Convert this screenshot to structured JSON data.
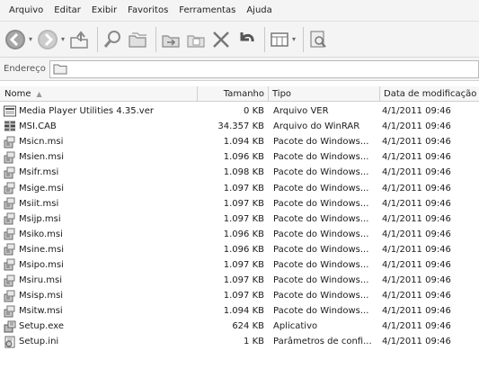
{
  "menu": [
    "Arquivo",
    "Editar",
    "Exibir",
    "Favoritos",
    "Ferramentas",
    "Ajuda"
  ],
  "toolbar": {
    "icons": [
      "back-icon",
      "forward-icon",
      "up-folder-icon",
      "search-icon",
      "folders-icon",
      "move-to-icon",
      "copy-to-icon",
      "delete-icon",
      "undo-icon",
      "views-icon",
      "scan-icon"
    ]
  },
  "address": {
    "label": "Endereço"
  },
  "columns": {
    "name": "Nome",
    "size": "Tamanho",
    "type": "Tipo",
    "date": "Data de modificação"
  },
  "files": [
    {
      "name": "Media Player Utilities 4.35.ver",
      "size": "0 KB",
      "type": "Arquivo VER",
      "date": "4/1/2011 09:46",
      "icon": "ver-file-icon"
    },
    {
      "name": "MSI.CAB",
      "size": "34.357 KB",
      "type": "Arquivo do WinRAR",
      "date": "4/1/2011 09:46",
      "icon": "winrar-archive-icon"
    },
    {
      "name": "Msicn.msi",
      "size": "1.094 KB",
      "type": "Pacote do Windows...",
      "date": "4/1/2011 09:46",
      "icon": "msi-package-icon"
    },
    {
      "name": "Msien.msi",
      "size": "1.096 KB",
      "type": "Pacote do Windows...",
      "date": "4/1/2011 09:46",
      "icon": "msi-package-icon"
    },
    {
      "name": "Msifr.msi",
      "size": "1.098 KB",
      "type": "Pacote do Windows...",
      "date": "4/1/2011 09:46",
      "icon": "msi-package-icon"
    },
    {
      "name": "Msige.msi",
      "size": "1.097 KB",
      "type": "Pacote do Windows...",
      "date": "4/1/2011 09:46",
      "icon": "msi-package-icon"
    },
    {
      "name": "Msiit.msi",
      "size": "1.097 KB",
      "type": "Pacote do Windows...",
      "date": "4/1/2011 09:46",
      "icon": "msi-package-icon"
    },
    {
      "name": "Msijp.msi",
      "size": "1.097 KB",
      "type": "Pacote do Windows...",
      "date": "4/1/2011 09:46",
      "icon": "msi-package-icon"
    },
    {
      "name": "Msiko.msi",
      "size": "1.096 KB",
      "type": "Pacote do Windows...",
      "date": "4/1/2011 09:46",
      "icon": "msi-package-icon"
    },
    {
      "name": "Msine.msi",
      "size": "1.096 KB",
      "type": "Pacote do Windows...",
      "date": "4/1/2011 09:46",
      "icon": "msi-package-icon"
    },
    {
      "name": "Msipo.msi",
      "size": "1.097 KB",
      "type": "Pacote do Windows...",
      "date": "4/1/2011 09:46",
      "icon": "msi-package-icon"
    },
    {
      "name": "Msiru.msi",
      "size": "1.097 KB",
      "type": "Pacote do Windows...",
      "date": "4/1/2011 09:46",
      "icon": "msi-package-icon"
    },
    {
      "name": "Msisp.msi",
      "size": "1.097 KB",
      "type": "Pacote do Windows...",
      "date": "4/1/2011 09:46",
      "icon": "msi-package-icon"
    },
    {
      "name": "Msitw.msi",
      "size": "1.094 KB",
      "type": "Pacote do Windows...",
      "date": "4/1/2011 09:46",
      "icon": "msi-package-icon"
    },
    {
      "name": "Setup.exe",
      "size": "624 KB",
      "type": "Aplicativo",
      "date": "4/1/2011 09:46",
      "icon": "setup-exe-icon"
    },
    {
      "name": "Setup.ini",
      "size": "1 KB",
      "type": "Parâmetros de confi...",
      "date": "4/1/2011 09:46",
      "icon": "ini-settings-icon"
    }
  ]
}
